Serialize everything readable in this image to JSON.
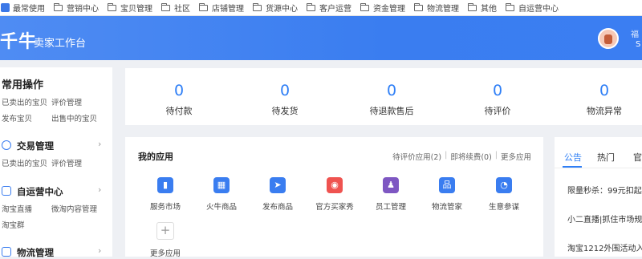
{
  "bookmarks": [
    {
      "label": "最常使用",
      "icon": "bookmark-star-icon"
    },
    {
      "label": "营销中心",
      "icon": "folder-icon"
    },
    {
      "label": "宝贝管理",
      "icon": "folder-icon"
    },
    {
      "label": "社区",
      "icon": "folder-icon"
    },
    {
      "label": "店铺管理",
      "icon": "folder-icon"
    },
    {
      "label": "货源中心",
      "icon": "folder-icon"
    },
    {
      "label": "客户运营",
      "icon": "folder-icon"
    },
    {
      "label": "资金管理",
      "icon": "folder-icon"
    },
    {
      "label": "物流管理",
      "icon": "folder-icon"
    },
    {
      "label": "其他",
      "icon": "folder-icon"
    },
    {
      "label": "自运营中心",
      "icon": "folder-icon"
    }
  ],
  "header": {
    "logo": "千牛",
    "subtitle": "卖家工作台",
    "user_name": "福",
    "user_sub": "S",
    "brand_color": "#3a7df0"
  },
  "sidebar": {
    "common_title": "常用操作",
    "common_links": [
      "已卖出的宝贝",
      "评价管理",
      "发布宝贝",
      "出售中的宝贝"
    ],
    "sections": [
      {
        "title": "交易管理",
        "icon": "trade-icon",
        "links": [
          "已卖出的宝贝",
          "评价管理"
        ]
      },
      {
        "title": "自运营中心",
        "icon": "chat-icon",
        "links": [
          "淘宝直播",
          "微淘内容管理",
          "淘宝群"
        ]
      },
      {
        "title": "物流管理",
        "icon": "logistics-icon",
        "links": []
      }
    ]
  },
  "stats": [
    {
      "value": "0",
      "label": "待付款"
    },
    {
      "value": "0",
      "label": "待发货"
    },
    {
      "value": "0",
      "label": "待退款售后"
    },
    {
      "value": "0",
      "label": "待评价"
    },
    {
      "value": "0",
      "label": "物流异常"
    }
  ],
  "apps": {
    "title": "我的应用",
    "links": [
      "待评价应用(2)",
      "即将续费(0)",
      "更多应用"
    ],
    "items": [
      {
        "label": "服务市场",
        "icon": "service-market-icon",
        "color": "#3a7df0",
        "glyph": "▮"
      },
      {
        "label": "火牛商品",
        "icon": "huoniu-icon",
        "color": "#3a7df0",
        "glyph": "▦"
      },
      {
        "label": "发布商品",
        "icon": "publish-icon",
        "color": "#3a7df0",
        "glyph": "➤"
      },
      {
        "label": "官方买家秀",
        "icon": "buyer-show-icon",
        "color": "#ef5350",
        "glyph": "◉"
      },
      {
        "label": "员工管理",
        "icon": "staff-icon",
        "color": "#7e57c2",
        "glyph": "♟"
      },
      {
        "label": "物流管家",
        "icon": "logistics-keeper-icon",
        "color": "#3a7df0",
        "glyph": "品"
      },
      {
        "label": "生意参谋",
        "icon": "business-advisor-icon",
        "color": "#3a7df0",
        "glyph": "◔"
      }
    ],
    "more_label": "更多应用"
  },
  "notices": {
    "tabs": [
      "公告",
      "热门",
      "官"
    ],
    "items": [
      "限量秒杀：99元扣起",
      "小二直播|抓住市场规",
      "淘宝1212外围活动入"
    ]
  }
}
